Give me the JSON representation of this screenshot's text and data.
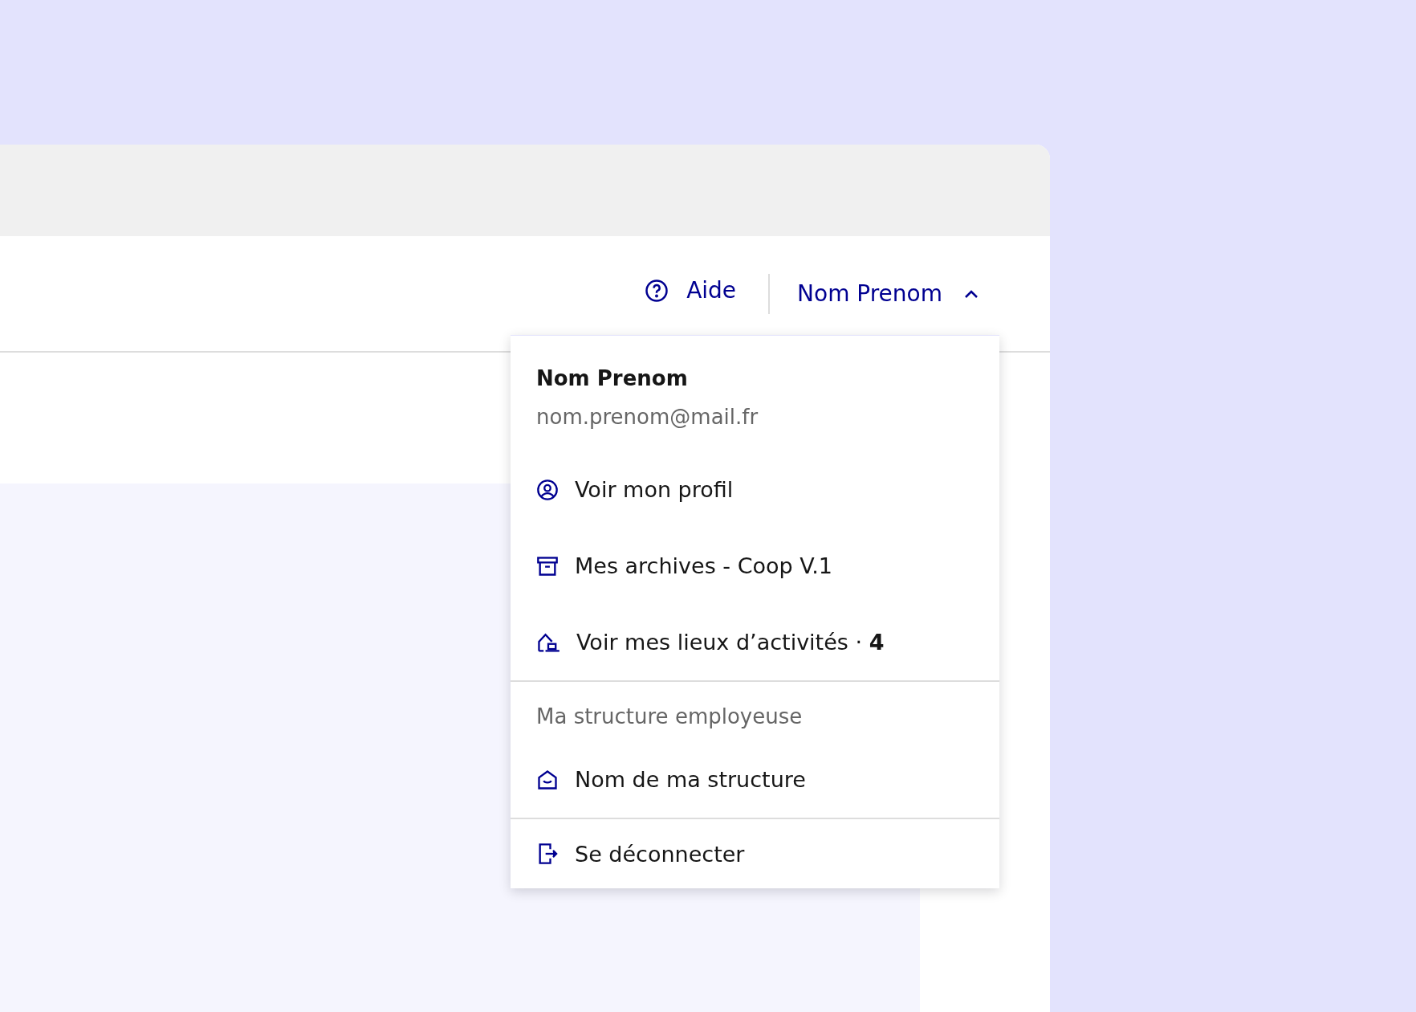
{
  "header": {
    "help_link": "Aide",
    "account_menu": {
      "label": "Nom Prenom",
      "expanded": true
    }
  },
  "dropdown": {
    "user_name": "Nom Prenom",
    "user_email": "nom.prenom@mail.fr",
    "items": [
      {
        "label": "Voir mon profil"
      },
      {
        "label": "Mes archives - Coop V.1"
      },
      {
        "label": "Voir mes lieux d’activités · **4**"
      }
    ],
    "section_title": "Ma structure employeuse",
    "structure_item": {
      "label": "Nom de ma structure"
    },
    "logout": {
      "label": "Se déconnecter"
    }
  }
}
